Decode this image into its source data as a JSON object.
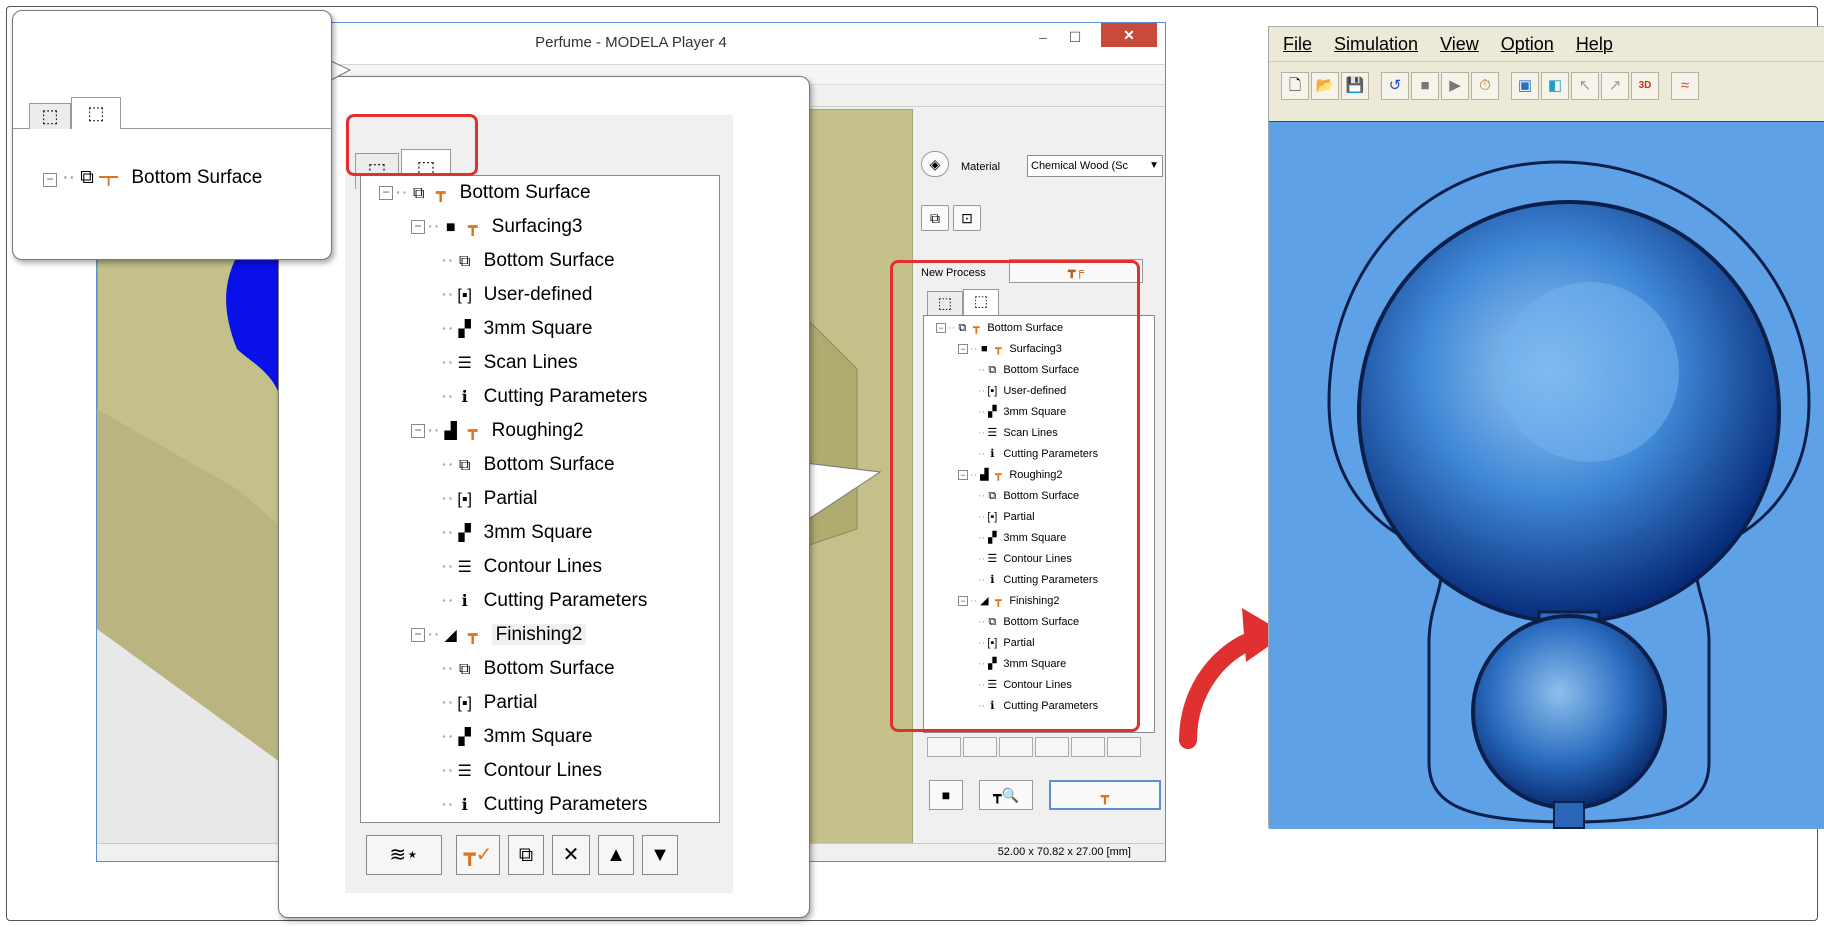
{
  "main_window": {
    "title": "Perfume - MODELA Player 4",
    "controls": {
      "minimize": "–",
      "maximize": "☐",
      "close": "✕"
    },
    "material": {
      "label": "Material",
      "value": "Chemical Wood (Sc"
    },
    "new_process_label": "New Process",
    "status_dimensions": "52.00 x 70.82 x 27.00 [mm]"
  },
  "small_callout": {
    "root_label": "Bottom Surface"
  },
  "process_tree": [
    {
      "level": 0,
      "kind": "root",
      "label": "Bottom Surface"
    },
    {
      "level": 1,
      "kind": "process",
      "label": "Surfacing3"
    },
    {
      "level": 2,
      "kind": "item",
      "icon": "surface",
      "label": "Bottom Surface"
    },
    {
      "level": 2,
      "kind": "item",
      "icon": "area",
      "label": "User-defined"
    },
    {
      "level": 2,
      "kind": "item",
      "icon": "tool",
      "label": "3mm Square"
    },
    {
      "level": 2,
      "kind": "item",
      "icon": "lines",
      "label": "Scan Lines"
    },
    {
      "level": 2,
      "kind": "item",
      "icon": "info",
      "label": "Cutting Parameters"
    },
    {
      "level": 1,
      "kind": "process",
      "label": "Roughing2"
    },
    {
      "level": 2,
      "kind": "item",
      "icon": "surface",
      "label": "Bottom Surface"
    },
    {
      "level": 2,
      "kind": "item",
      "icon": "area",
      "label": "Partial"
    },
    {
      "level": 2,
      "kind": "item",
      "icon": "tool",
      "label": "3mm Square"
    },
    {
      "level": 2,
      "kind": "item",
      "icon": "lines",
      "label": "Contour Lines"
    },
    {
      "level": 2,
      "kind": "item",
      "icon": "info",
      "label": "Cutting Parameters"
    },
    {
      "level": 1,
      "kind": "process",
      "label": "Finishing2"
    },
    {
      "level": 2,
      "kind": "item",
      "icon": "surface",
      "label": "Bottom Surface"
    },
    {
      "level": 2,
      "kind": "item",
      "icon": "area",
      "label": "Partial"
    },
    {
      "level": 2,
      "kind": "item",
      "icon": "tool",
      "label": "3mm Square"
    },
    {
      "level": 2,
      "kind": "item",
      "icon": "lines",
      "label": "Contour Lines"
    },
    {
      "level": 2,
      "kind": "item",
      "icon": "info",
      "label": "Cutting Parameters"
    }
  ],
  "simulation_window": {
    "menu": [
      {
        "label": "File"
      },
      {
        "label": "Simulation"
      },
      {
        "label": "View"
      },
      {
        "label": "Option"
      },
      {
        "label": "Help"
      }
    ]
  },
  "colors": {
    "highlight_red": "#e03030",
    "sim_background": "#5ea1e6",
    "process_icon_orange": "#e0741c",
    "model_blue": "#0a10e8",
    "model_olive": "#c4c08a"
  }
}
